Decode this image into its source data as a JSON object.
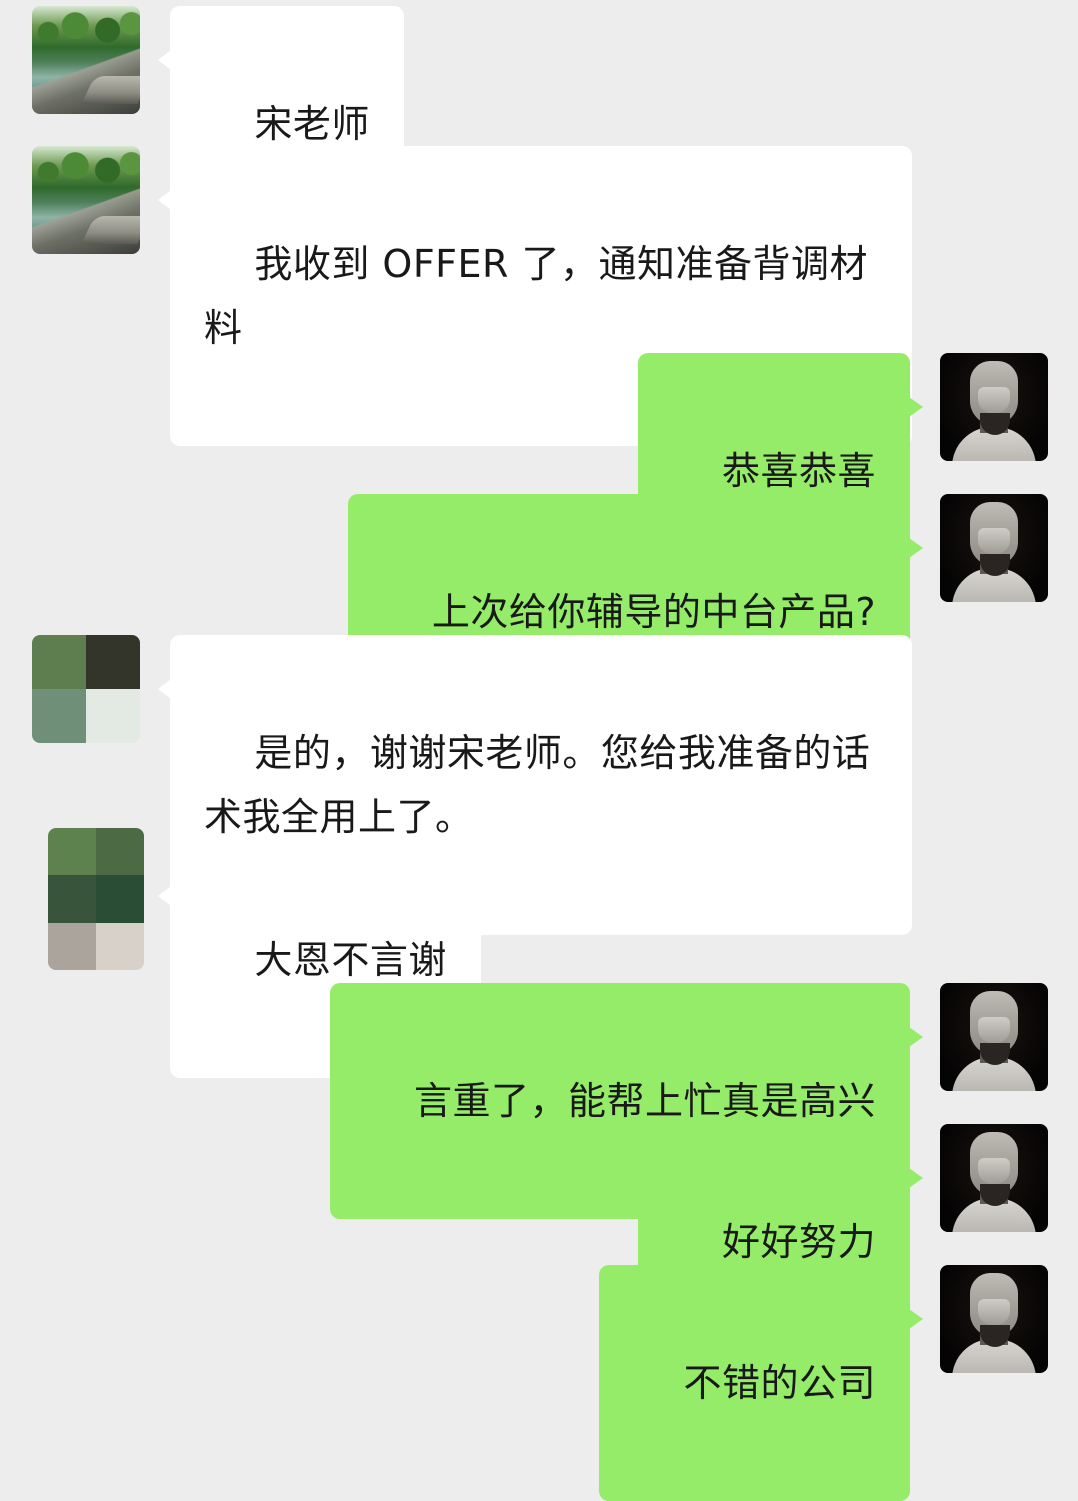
{
  "chat": {
    "messages": [
      {
        "sender": "contact",
        "avatar": "landscape-avatar",
        "text": "宋老师"
      },
      {
        "sender": "contact",
        "avatar": "landscape-avatar",
        "text": "我收到 OFFER 了，通知准备背调材料"
      },
      {
        "sender": "me",
        "avatar": "statue-avatar",
        "text": "恭喜恭喜"
      },
      {
        "sender": "me",
        "avatar": "statue-avatar",
        "text": "上次给你辅导的中台产品?"
      },
      {
        "sender": "contact",
        "avatar": "pixelated-avatar",
        "text": "是的，谢谢宋老师。您给我准备的话术我全用上了。"
      },
      {
        "sender": "contact",
        "avatar": "pixelated-avatar",
        "text": "大恩不言谢"
      },
      {
        "sender": "me",
        "avatar": "statue-avatar",
        "text": "言重了，能帮上忙真是高兴"
      },
      {
        "sender": "me",
        "avatar": "statue-avatar",
        "text": "好好努力"
      },
      {
        "sender": "me",
        "avatar": "statue-avatar",
        "text": "不错的公司"
      }
    ]
  },
  "colors": {
    "background": "#ededed",
    "incoming_bubble": "#ffffff",
    "outgoing_bubble": "#95ec69",
    "text": "#191919"
  }
}
